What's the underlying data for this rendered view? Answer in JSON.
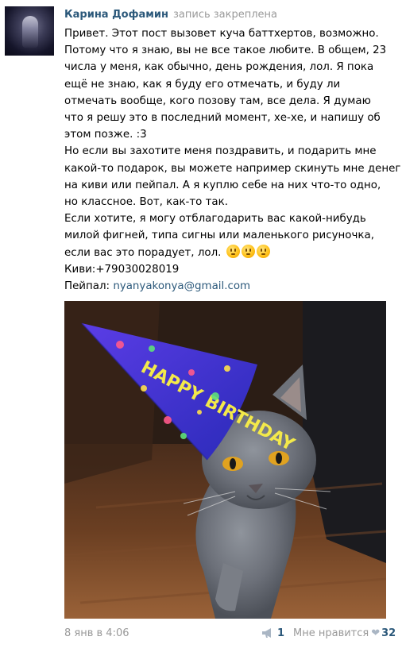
{
  "post": {
    "author": "Карина Дофамин",
    "status": "запись закреплена",
    "text_lines": [
      "Привет. Этот пост вызовет куча баттхертов, возможно.",
      "Потому что я знаю, вы не все такое любите. В общем, 23",
      "числа у меня, как обычно, день рождения, лол. Я пока",
      "ещё не знаю, как я буду его отмечать, и буду ли",
      "отмечать вообще, кого позову там, все дела. Я думаю",
      "что я решу это в последний момент, хе-хе, и напишу об",
      "этом позже. :3",
      "Но если вы захотите меня поздравить, и подарить мне",
      "какой-то подарок, вы можете например скинуть мне денег",
      "на киви или пейпал. А я куплю себе на них что-то одно,",
      "но классное. Вот, как-то так.",
      "Если хотите, я могу отблагодарить вас какой-нибудь",
      "милой фигней, типа сигны или маленького рисуночка,",
      "если вас это порадует, лол."
    ],
    "qiwi": "Киви:+79030028019",
    "paypal_label": "Пейпал: ",
    "paypal_email": "nyanyakonya@gmail.com",
    "photo_hat_text": "HAPPY BIRTHDAY",
    "date": "8 янв в 4:06",
    "shares": "1",
    "like_label": "Мне нравится",
    "likes": "32"
  },
  "colors": {
    "link": "#2b587a",
    "muted": "#999999",
    "hat": "#3a3adf"
  },
  "icons": [
    "avatar",
    "emoji-face-icon",
    "megaphone-icon",
    "heart-icon"
  ]
}
